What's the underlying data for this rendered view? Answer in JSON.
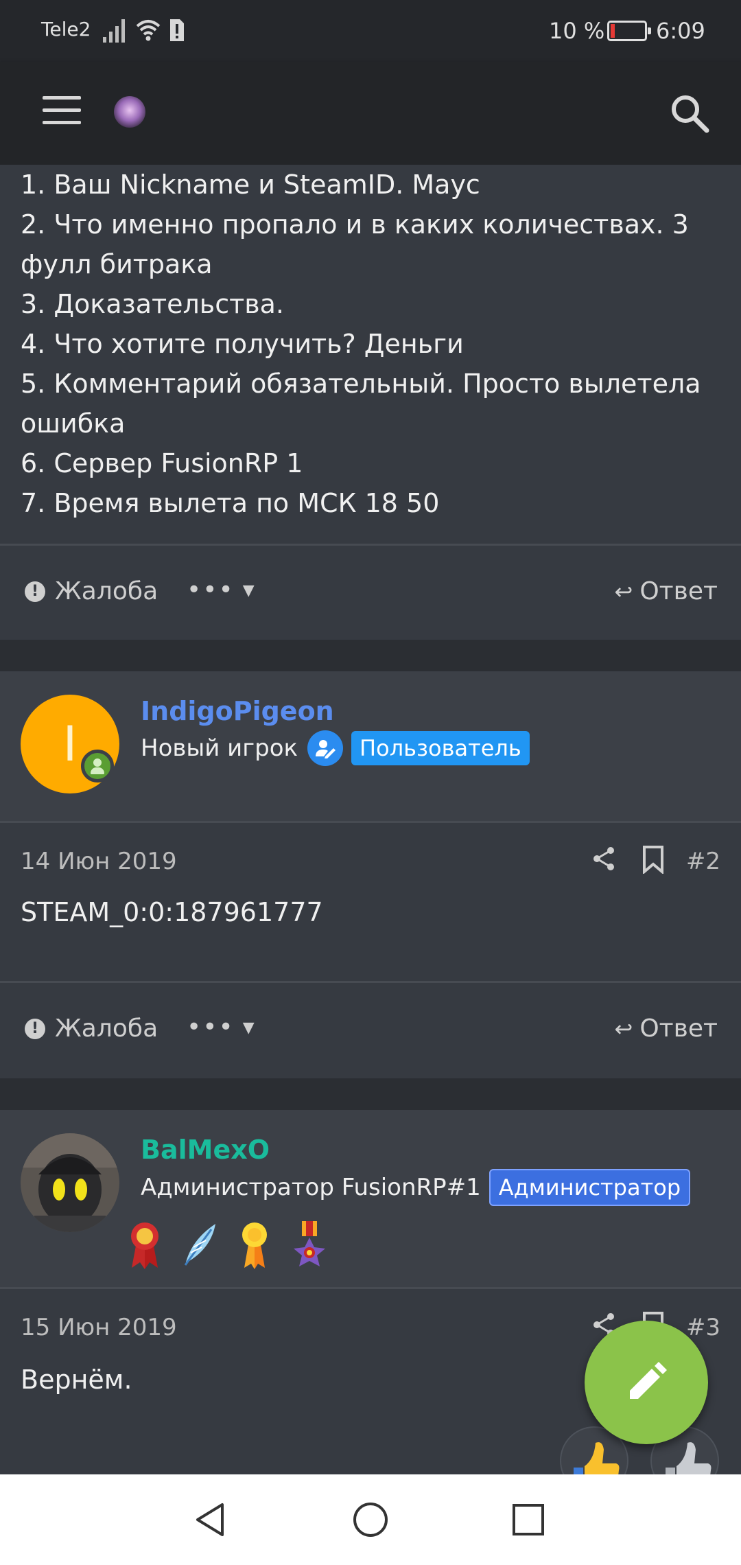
{
  "status_bar": {
    "carrier": "Tele2",
    "battery_percent": "10 %",
    "battery_level": 0.1,
    "time": "6:09",
    "icons": [
      "signal-icon",
      "wifi-icon",
      "sim-alert-icon",
      "battery-icon"
    ]
  },
  "header": {
    "menu_icon": "hamburger-menu-icon",
    "logo": "site-logo",
    "search_icon": "search-icon"
  },
  "post1": {
    "lines": [
      "1. Ваш Nickname и SteamID. Маус",
      "2. Что именно пропало и в каких количествах. 3",
      "фулл битрака",
      "3. Доказательства.",
      "4. Что хотите получить? Деньги",
      "5. Комментарий обязательный. Просто вылетела",
      "ошибка",
      "6. Сервер FusionRP 1",
      "7. Время вылета по МСК 18 50"
    ],
    "report_label": "Жалоба",
    "more_label": "•••",
    "reply_label": "Ответ"
  },
  "post2": {
    "avatar_letter": "I",
    "avatar_color": "#ffab00",
    "username": "IndigoPigeon",
    "username_color": "#5b8def",
    "user_title": "Новый игрок",
    "badge": "Пользователь",
    "date": "14 Июн 2019",
    "number": "#2",
    "body": "STEAM_0:0:187961777",
    "report_label": "Жалоба",
    "more_label": "•••",
    "reply_label": "Ответ"
  },
  "post3": {
    "username": "BalMexO",
    "username_color": "#1abc9c",
    "user_title": "Администратор FusionRP#1",
    "badge": "Администратор",
    "awards": [
      "red-ribbon-award-icon",
      "feather-award-icon",
      "gold-medal-award-icon",
      "order-medal-award-icon"
    ],
    "date": "15 Июн 2019",
    "number": "#3",
    "body": "Вернём."
  },
  "fab": {
    "icon": "pencil-icon"
  },
  "reactions": [
    "like-reaction-icon",
    "thumb-reaction-icon"
  ],
  "nav": [
    "back-icon",
    "home-icon",
    "recents-icon"
  ]
}
